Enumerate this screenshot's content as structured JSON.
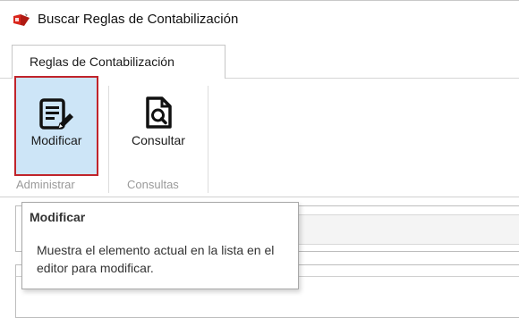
{
  "window": {
    "title": "Buscar Reglas de Contabilización",
    "icon": "app-logo-icon"
  },
  "ribbon": {
    "tabs": [
      {
        "label": "Reglas de Contabilización",
        "active": true
      }
    ],
    "groups": [
      {
        "label": "Administrar",
        "buttons": [
          {
            "label": "Modificar",
            "icon": "edit-document-icon",
            "selected": true
          }
        ]
      },
      {
        "label": "Consultas",
        "buttons": [
          {
            "label": "Consultar",
            "icon": "search-document-icon",
            "selected": false
          }
        ]
      }
    ]
  },
  "tooltip": {
    "title": "Modificar",
    "body": "Muestra el elemento actual en la lista en el editor para modificar."
  },
  "colors": {
    "selected_bg": "#cde5f7",
    "highlight_border": "#c0242b",
    "group_label": "#9a9a9a"
  }
}
